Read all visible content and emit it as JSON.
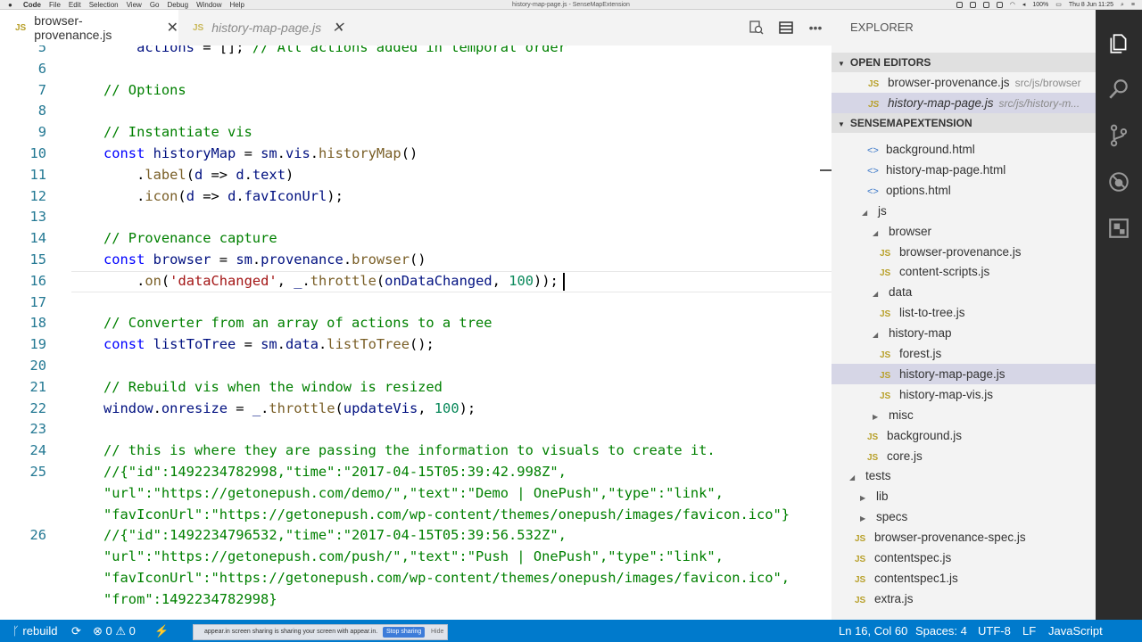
{
  "menubar": {
    "apple": "",
    "menus": [
      "Code",
      "File",
      "Edit",
      "Selection",
      "View",
      "Go",
      "Debug",
      "Window",
      "Help"
    ],
    "window_title": "history-map-page.js - SenseMapExtension",
    "battery": "100%",
    "clock": "Thu 8 Jun  11:25"
  },
  "tabs": [
    {
      "icon": "JS",
      "label": "browser-provenance.js",
      "close": "✕"
    },
    {
      "icon": "JS",
      "label": "history-map-page.js",
      "close": "✕"
    }
  ],
  "editor_actions": [
    "split-find-icon",
    "layout-icon",
    "more-icon"
  ],
  "more_label": "•••",
  "code_lines": [
    {
      "n": "5",
      "parts": [
        {
          "c": "var",
          "t": "    actions"
        },
        {
          "c": "",
          "t": " = []; "
        },
        {
          "c": "cmt",
          "t": "// All actions added in temporal order"
        }
      ]
    },
    {
      "n": "6",
      "parts": []
    },
    {
      "n": "7",
      "parts": [
        {
          "c": "cmt",
          "t": "// Options"
        }
      ]
    },
    {
      "n": "8",
      "parts": []
    },
    {
      "n": "9",
      "parts": [
        {
          "c": "cmt",
          "t": "// Instantiate vis"
        }
      ]
    },
    {
      "n": "10",
      "parts": [
        {
          "c": "kw",
          "t": "const"
        },
        {
          "c": "",
          "t": " "
        },
        {
          "c": "var",
          "t": "historyMap"
        },
        {
          "c": "",
          "t": " = "
        },
        {
          "c": "var",
          "t": "sm"
        },
        {
          "c": "",
          "t": "."
        },
        {
          "c": "var",
          "t": "vis"
        },
        {
          "c": "",
          "t": "."
        },
        {
          "c": "fn",
          "t": "historyMap"
        },
        {
          "c": "",
          "t": "()"
        }
      ]
    },
    {
      "n": "11",
      "parts": [
        {
          "c": "",
          "t": "    ."
        },
        {
          "c": "fn",
          "t": "label"
        },
        {
          "c": "",
          "t": "("
        },
        {
          "c": "var",
          "t": "d"
        },
        {
          "c": "",
          "t": " => "
        },
        {
          "c": "var",
          "t": "d"
        },
        {
          "c": "",
          "t": "."
        },
        {
          "c": "var",
          "t": "text"
        },
        {
          "c": "",
          "t": ")"
        }
      ]
    },
    {
      "n": "12",
      "parts": [
        {
          "c": "",
          "t": "    ."
        },
        {
          "c": "fn",
          "t": "icon"
        },
        {
          "c": "",
          "t": "("
        },
        {
          "c": "var",
          "t": "d"
        },
        {
          "c": "",
          "t": " => "
        },
        {
          "c": "var",
          "t": "d"
        },
        {
          "c": "",
          "t": "."
        },
        {
          "c": "var",
          "t": "favIconUrl"
        },
        {
          "c": "",
          "t": ");"
        }
      ]
    },
    {
      "n": "13",
      "parts": []
    },
    {
      "n": "14",
      "parts": [
        {
          "c": "cmt",
          "t": "// Provenance capture"
        }
      ]
    },
    {
      "n": "15",
      "parts": [
        {
          "c": "kw",
          "t": "const"
        },
        {
          "c": "",
          "t": " "
        },
        {
          "c": "var",
          "t": "browser"
        },
        {
          "c": "",
          "t": " = "
        },
        {
          "c": "var",
          "t": "sm"
        },
        {
          "c": "",
          "t": "."
        },
        {
          "c": "var",
          "t": "provenance"
        },
        {
          "c": "",
          "t": "."
        },
        {
          "c": "fn",
          "t": "browser"
        },
        {
          "c": "",
          "t": "()"
        }
      ]
    },
    {
      "n": "16",
      "parts": [
        {
          "c": "",
          "t": "    ."
        },
        {
          "c": "fn",
          "t": "on"
        },
        {
          "c": "",
          "t": "("
        },
        {
          "c": "str",
          "t": "'dataChanged'"
        },
        {
          "c": "",
          "t": ", "
        },
        {
          "c": "var",
          "t": "_"
        },
        {
          "c": "",
          "t": "."
        },
        {
          "c": "fn",
          "t": "throttle"
        },
        {
          "c": "",
          "t": "("
        },
        {
          "c": "var",
          "t": "onDataChanged"
        },
        {
          "c": "",
          "t": ", "
        },
        {
          "c": "num",
          "t": "100"
        },
        {
          "c": "",
          "t": "));"
        }
      ]
    },
    {
      "n": "17",
      "parts": []
    },
    {
      "n": "18",
      "parts": [
        {
          "c": "cmt",
          "t": "// Converter from an array of actions to a tree"
        }
      ]
    },
    {
      "n": "19",
      "parts": [
        {
          "c": "kw",
          "t": "const"
        },
        {
          "c": "",
          "t": " "
        },
        {
          "c": "var",
          "t": "listToTree"
        },
        {
          "c": "",
          "t": " = "
        },
        {
          "c": "var",
          "t": "sm"
        },
        {
          "c": "",
          "t": "."
        },
        {
          "c": "var",
          "t": "data"
        },
        {
          "c": "",
          "t": "."
        },
        {
          "c": "fn",
          "t": "listToTree"
        },
        {
          "c": "",
          "t": "();"
        }
      ]
    },
    {
      "n": "20",
      "parts": []
    },
    {
      "n": "21",
      "parts": [
        {
          "c": "cmt",
          "t": "// Rebuild vis when the window is resized"
        }
      ]
    },
    {
      "n": "22",
      "parts": [
        {
          "c": "var",
          "t": "window"
        },
        {
          "c": "",
          "t": "."
        },
        {
          "c": "var",
          "t": "onresize"
        },
        {
          "c": "",
          "t": " = "
        },
        {
          "c": "var",
          "t": "_"
        },
        {
          "c": "",
          "t": "."
        },
        {
          "c": "fn",
          "t": "throttle"
        },
        {
          "c": "",
          "t": "("
        },
        {
          "c": "var",
          "t": "updateVis"
        },
        {
          "c": "",
          "t": ", "
        },
        {
          "c": "num",
          "t": "100"
        },
        {
          "c": "",
          "t": ");"
        }
      ]
    },
    {
      "n": "23",
      "parts": []
    },
    {
      "n": "24",
      "parts": [
        {
          "c": "cmt",
          "t": "// this is where they are passing the information to visuals to create it."
        }
      ]
    },
    {
      "n": "25",
      "parts": [
        {
          "c": "cmt",
          "t": "//{\"id\":1492234782998,\"time\":\"2017-04-15T05:39:42.998Z\","
        }
      ]
    },
    {
      "n": "",
      "parts": [
        {
          "c": "cmt",
          "t": "\"url\":\"https://getonepush.com/demo/\",\"text\":\"Demo | OnePush\",\"type\":\"link\","
        }
      ]
    },
    {
      "n": "",
      "parts": [
        {
          "c": "cmt",
          "t": "\"favIconUrl\":\"https://getonepush.com/wp-content/themes/onepush/images/favicon.ico\"}"
        }
      ]
    },
    {
      "n": "26",
      "parts": [
        {
          "c": "cmt",
          "t": "//{\"id\":1492234796532,\"time\":\"2017-04-15T05:39:56.532Z\","
        }
      ]
    },
    {
      "n": "",
      "parts": [
        {
          "c": "cmt",
          "t": "\"url\":\"https://getonepush.com/push/\",\"text\":\"Push | OnePush\",\"type\":\"link\","
        }
      ]
    },
    {
      "n": "",
      "parts": [
        {
          "c": "cmt",
          "t": "\"favIconUrl\":\"https://getonepush.com/wp-content/themes/onepush/images/favicon.ico\","
        }
      ]
    },
    {
      "n": "",
      "parts": [
        {
          "c": "cmt",
          "t": "\"from\":1492234782998}"
        }
      ]
    }
  ],
  "sidebar": {
    "title": "EXPLORER",
    "open_editors_header": "OPEN EDITORS",
    "project_header": "SENSEMAPEXTENSION",
    "open_editors": [
      {
        "icon": "JS",
        "label": "browser-provenance.js",
        "path": "src/js/browser"
      },
      {
        "icon": "JS",
        "label": "history-map-page.js",
        "path": "src/js/history-m..."
      }
    ],
    "tree": [
      {
        "type": "html",
        "icon": "<>",
        "label": "background.html",
        "indent": 40
      },
      {
        "type": "html",
        "icon": "<>",
        "label": "history-map-page.html",
        "indent": 40
      },
      {
        "type": "html",
        "icon": "<>",
        "label": "options.html",
        "indent": 40
      },
      {
        "type": "folder",
        "twist": "◢",
        "label": "js",
        "indent": 34
      },
      {
        "type": "folder",
        "twist": "◢",
        "label": "browser",
        "indent": 46
      },
      {
        "type": "js",
        "icon": "JS",
        "label": "browser-provenance.js",
        "indent": 54
      },
      {
        "type": "js",
        "icon": "JS",
        "label": "content-scripts.js",
        "indent": 54
      },
      {
        "type": "folder",
        "twist": "◢",
        "label": "data",
        "indent": 46
      },
      {
        "type": "js",
        "icon": "JS",
        "label": "list-to-tree.js",
        "indent": 54
      },
      {
        "type": "folder",
        "twist": "◢",
        "label": "history-map",
        "indent": 46
      },
      {
        "type": "js",
        "icon": "JS",
        "label": "forest.js",
        "indent": 54
      },
      {
        "type": "js",
        "icon": "JS",
        "label": "history-map-page.js",
        "indent": 54,
        "selected": true
      },
      {
        "type": "js",
        "icon": "JS",
        "label": "history-map-vis.js",
        "indent": 54
      },
      {
        "type": "folder",
        "twist": "▶",
        "label": "misc",
        "indent": 46
      },
      {
        "type": "js",
        "icon": "JS",
        "label": "background.js",
        "indent": 40
      },
      {
        "type": "js",
        "icon": "JS",
        "label": "core.js",
        "indent": 40
      },
      {
        "type": "folder",
        "twist": "◢",
        "label": "tests",
        "indent": 20
      },
      {
        "type": "folder",
        "twist": "▶",
        "label": "lib",
        "indent": 32
      },
      {
        "type": "folder",
        "twist": "▶",
        "label": "specs",
        "indent": 32
      },
      {
        "type": "js",
        "icon": "JS",
        "label": "browser-provenance-spec.js",
        "indent": 26
      },
      {
        "type": "js",
        "icon": "JS",
        "label": "contentspec.js",
        "indent": 26
      },
      {
        "type": "js",
        "icon": "JS",
        "label": "contentspec1.js",
        "indent": 26
      },
      {
        "type": "js",
        "icon": "JS",
        "label": "extra.js",
        "indent": 26
      }
    ]
  },
  "statusbar": {
    "branch": "rebuild",
    "errors": "0",
    "warnings": "0",
    "position": "Ln 16, Col 60",
    "spaces": "Spaces: 4",
    "encoding": "UTF-8",
    "eol": "LF",
    "language": "JavaScript"
  },
  "share_banner": {
    "message": "appear.in screen sharing is sharing your screen with appear.in.",
    "stop": "Stop sharing",
    "hide": "Hide"
  },
  "colors": {
    "accent": "#007acc",
    "activity_bar": "#2c2c2c",
    "comment": "#008000",
    "keyword": "#0000ff",
    "string": "#a31515"
  }
}
